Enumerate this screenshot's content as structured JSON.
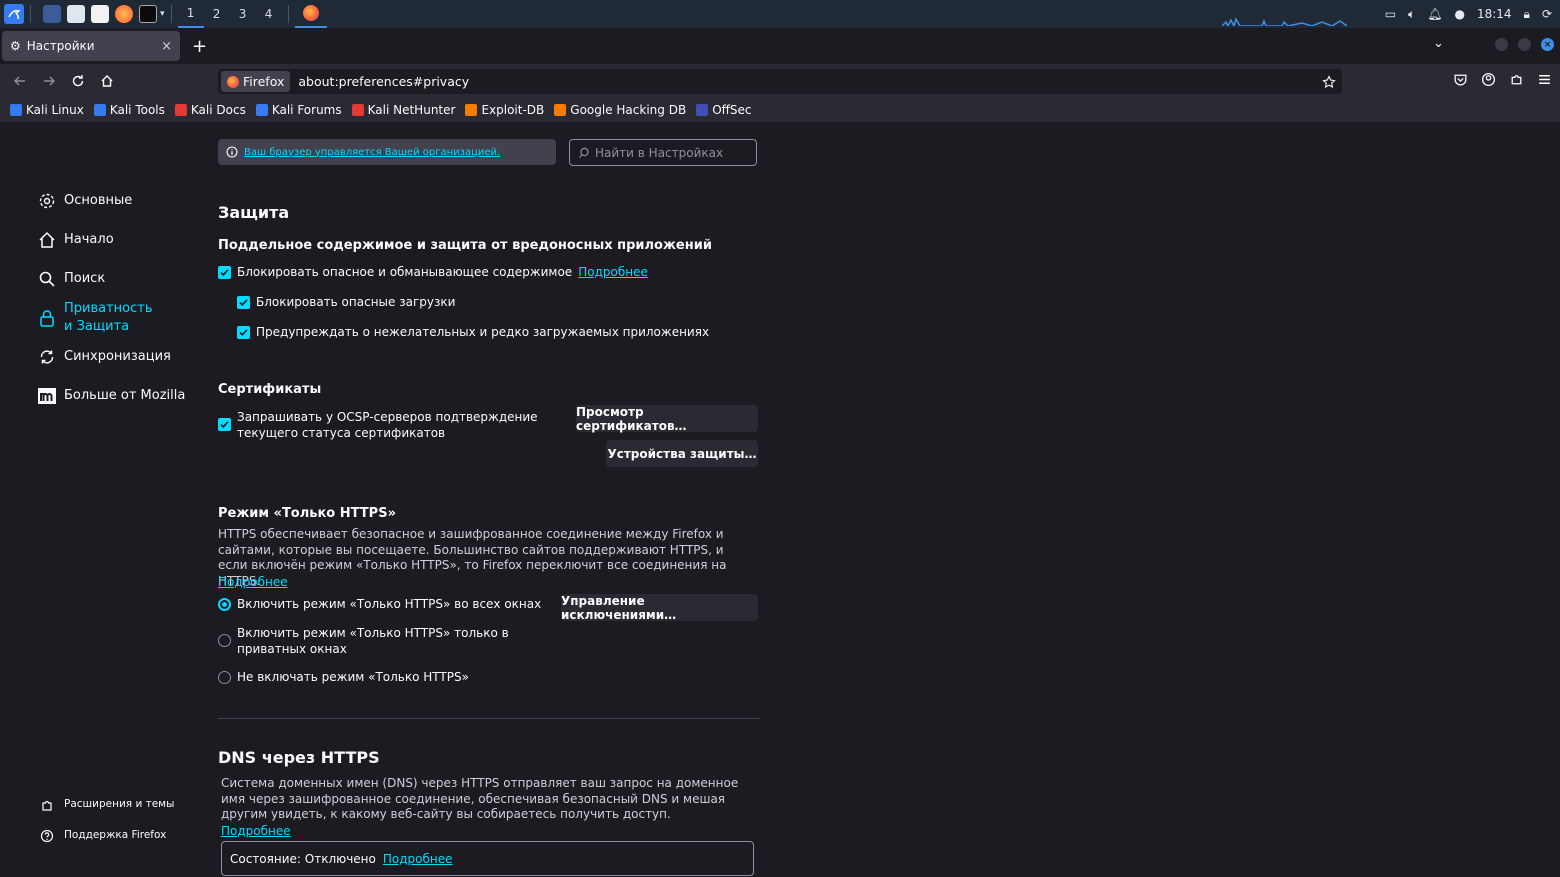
{
  "taskbar": {
    "workspaces": [
      "1",
      "2",
      "3",
      "4"
    ],
    "time": "18:14"
  },
  "tab": {
    "title": "Настройки",
    "close": "×",
    "new_tab": "+"
  },
  "urlbar": {
    "identity": "Firefox",
    "url": "about:preferences#privacy"
  },
  "bookmarks": [
    {
      "label": "Kali Linux",
      "color": "#367bf0"
    },
    {
      "label": "Kali Tools",
      "color": "#367bf0"
    },
    {
      "label": "Kali Docs",
      "color": "#e53935"
    },
    {
      "label": "Kali Forums",
      "color": "#367bf0"
    },
    {
      "label": "Kali NetHunter",
      "color": "#e53935"
    },
    {
      "label": "Exploit-DB",
      "color": "#f57c00"
    },
    {
      "label": "Google Hacking DB",
      "color": "#f57c00"
    },
    {
      "label": "OffSec",
      "color": "#3f51b5"
    }
  ],
  "sidebar": {
    "items": [
      {
        "label": "Основные",
        "icon": "gear-icon"
      },
      {
        "label": "Начало",
        "icon": "home-icon"
      },
      {
        "label": "Поиск",
        "icon": "search-icon"
      },
      {
        "label": "Приватность и Защита",
        "icon": "lock-icon",
        "selected": true
      },
      {
        "label": "Синхронизация",
        "icon": "sync-icon"
      },
      {
        "label": "Больше от Mozilla",
        "icon": "mozilla-icon"
      }
    ],
    "footer": [
      {
        "label": "Расширения и темы",
        "icon": "puzzle-icon"
      },
      {
        "label": "Поддержка Firefox",
        "icon": "help-icon"
      }
    ]
  },
  "main": {
    "policy_notice": "Ваш браузер управляется Вашей организацией.",
    "search_placeholder": "Найти в Настройках",
    "section_title": "Защита",
    "deceptive": {
      "title": "Поддельное содержимое и защита от вредоносных приложений",
      "block_dangerous": "Блокировать опасное и обманывающее содержимое",
      "learn_more": "Подробнее",
      "block_downloads": "Блокировать опасные загрузки",
      "warn_unwanted": "Предупреждать о нежелательных и редко загружаемых приложениях"
    },
    "certificates": {
      "title": "Сертификаты",
      "ocsp": "Запрашивать у OCSP-серверов подтверждение текущего статуса сертификатов",
      "view_button": "Просмотр сертификатов…",
      "devices_button": "Устройства защиты…"
    },
    "https_only": {
      "title": "Режим «Только HTTPS»",
      "description": "HTTPS обеспечивает безопасное и зашифрованное соединение между Firefox и сайтами, которые вы посещаете. Большинство сайтов поддерживают HTTPS, и если включён режим «Только HTTPS», то Firefox переключит все соединения на HTTPS.",
      "learn_more": "Подробнее",
      "opt_all": "Включить режим «Только HTTPS» во всех окнах",
      "opt_private": "Включить режим «Только HTTPS» только в приватных окнах",
      "opt_off": "Не включать режим «Только HTTPS»",
      "exceptions_button": "Управление исключениями…"
    },
    "dns": {
      "title": "DNS через HTTPS",
      "description": "Система доменных имен (DNS) через HTTPS отправляет ваш запрос на доменное имя через зашифрованное соединение, обеспечивая безопасный DNS и мешая другим увидеть, к какому веб-сайту вы собираетесь получить доступ.",
      "learn_more": "Подробнее",
      "status": "Состояние: Отключено",
      "status_learn_more": "Подробнее"
    }
  }
}
